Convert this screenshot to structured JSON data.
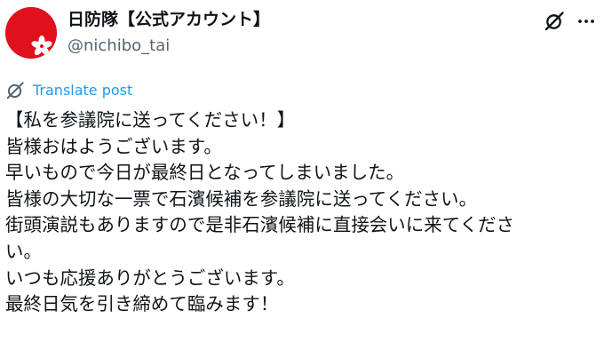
{
  "author": {
    "display_name": "日防隊【公式アカウント】",
    "handle": "@nichibo_tai",
    "avatar_color": "#e0111d"
  },
  "header_actions": [
    {
      "icon": "grok-icon"
    },
    {
      "icon": "more-icon",
      "label": "···"
    }
  ],
  "translate": {
    "icon": "translate-icon",
    "label": "Translate post",
    "color": "#1d9bf0"
  },
  "post": {
    "lines": [
      "【私を参議院に送ってください！】",
      "皆様おはようございます。",
      "早いもので今日が最終日となってしまいました。",
      "皆様の大切な一票で石濱候補を参議院に送ってください。",
      "街頭演説もありますので是非石濱候補に直接会いに来てくださ",
      "い。",
      "いつも応援ありがとうございます。",
      "最終日気を引き締めて臨みます！"
    ]
  }
}
